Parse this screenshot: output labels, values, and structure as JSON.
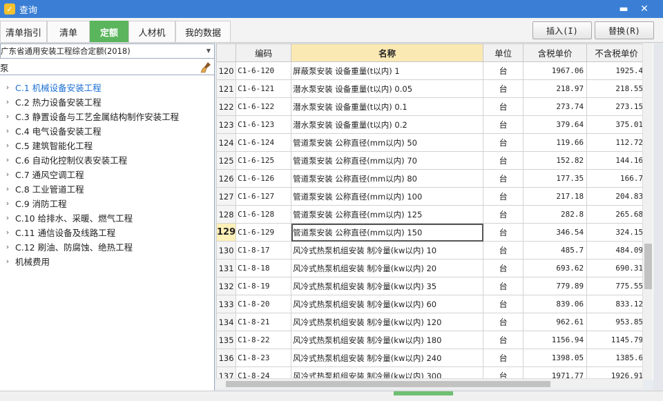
{
  "window": {
    "title": "查询"
  },
  "tabs": [
    {
      "label": "清单指引",
      "active": false
    },
    {
      "label": "清单",
      "active": false
    },
    {
      "label": "定额",
      "active": true
    },
    {
      "label": "人材机",
      "active": false
    },
    {
      "label": "我的数据",
      "active": false
    }
  ],
  "actions": {
    "insert": "插入(I)",
    "replace": "替换(R)"
  },
  "library": {
    "selected": "广东省通用安装工程综合定额(2018)"
  },
  "search": {
    "value": "泵"
  },
  "tree": [
    {
      "label": "C.1 机械设备安装工程",
      "selected": true
    },
    {
      "label": "C.2 热力设备安装工程",
      "selected": false
    },
    {
      "label": "C.3 静置设备与工艺金属结构制作安装工程",
      "selected": false
    },
    {
      "label": "C.4 电气设备安装工程",
      "selected": false
    },
    {
      "label": "C.5 建筑智能化工程",
      "selected": false
    },
    {
      "label": "C.6 自动化控制仪表安装工程",
      "selected": false
    },
    {
      "label": "C.7 通风空调工程",
      "selected": false
    },
    {
      "label": "C.8 工业管道工程",
      "selected": false
    },
    {
      "label": "C.9 消防工程",
      "selected": false
    },
    {
      "label": "C.10 给排水、采暖、燃气工程",
      "selected": false
    },
    {
      "label": "C.11 通信设备及线路工程",
      "selected": false
    },
    {
      "label": "C.12 刷油、防腐蚀、绝热工程",
      "selected": false
    },
    {
      "label": "机械费用",
      "selected": false
    }
  ],
  "table": {
    "headers": {
      "code": "编码",
      "name": "名称",
      "unit": "单位",
      "price_tax": "含税单价",
      "price_notax": "不含税单价"
    },
    "current_row": "129",
    "rows": [
      {
        "no": "120",
        "code": "C1-6-120",
        "name": "屏蔽泵安装 设备重量(t以内) 1",
        "unit": "台",
        "price_tax": "1967.06",
        "price_notax": "1925.4"
      },
      {
        "no": "121",
        "code": "C1-6-121",
        "name": "潜水泵安装 设备重量(t以内) 0.05",
        "unit": "台",
        "price_tax": "218.97",
        "price_notax": "218.55"
      },
      {
        "no": "122",
        "code": "C1-6-122",
        "name": "潜水泵安装 设备重量(t以内) 0.1",
        "unit": "台",
        "price_tax": "273.74",
        "price_notax": "273.15"
      },
      {
        "no": "123",
        "code": "C1-6-123",
        "name": "潜水泵安装 设备重量(t以内) 0.2",
        "unit": "台",
        "price_tax": "379.64",
        "price_notax": "375.01"
      },
      {
        "no": "124",
        "code": "C1-6-124",
        "name": "管道泵安装 公称直径(mm以内) 50",
        "unit": "台",
        "price_tax": "119.66",
        "price_notax": "112.72"
      },
      {
        "no": "125",
        "code": "C1-6-125",
        "name": "管道泵安装 公称直径(mm以内) 70",
        "unit": "台",
        "price_tax": "152.82",
        "price_notax": "144.16"
      },
      {
        "no": "126",
        "code": "C1-6-126",
        "name": "管道泵安装 公称直径(mm以内) 80",
        "unit": "台",
        "price_tax": "177.35",
        "price_notax": "166.7"
      },
      {
        "no": "127",
        "code": "C1-6-127",
        "name": "管道泵安装 公称直径(mm以内) 100",
        "unit": "台",
        "price_tax": "217.18",
        "price_notax": "204.83"
      },
      {
        "no": "128",
        "code": "C1-6-128",
        "name": "管道泵安装 公称直径(mm以内) 125",
        "unit": "台",
        "price_tax": "282.8",
        "price_notax": "265.68"
      },
      {
        "no": "129",
        "code": "C1-6-129",
        "name": "管道泵安装 公称直径(mm以内) 150",
        "unit": "台",
        "price_tax": "346.54",
        "price_notax": "324.15"
      },
      {
        "no": "130",
        "code": "C1-8-17",
        "name": "风冷式热泵机组安装 制冷量(kw以内) 10",
        "unit": "台",
        "price_tax": "485.7",
        "price_notax": "484.09"
      },
      {
        "no": "131",
        "code": "C1-8-18",
        "name": "风冷式热泵机组安装 制冷量(kw以内) 20",
        "unit": "台",
        "price_tax": "693.62",
        "price_notax": "690.31"
      },
      {
        "no": "132",
        "code": "C1-8-19",
        "name": "风冷式热泵机组安装 制冷量(kw以内) 35",
        "unit": "台",
        "price_tax": "779.89",
        "price_notax": "775.55"
      },
      {
        "no": "133",
        "code": "C1-8-20",
        "name": "风冷式热泵机组安装 制冷量(kw以内) 60",
        "unit": "台",
        "price_tax": "839.06",
        "price_notax": "833.12"
      },
      {
        "no": "134",
        "code": "C1-8-21",
        "name": "风冷式热泵机组安装 制冷量(kw以内) 120",
        "unit": "台",
        "price_tax": "962.61",
        "price_notax": "953.85"
      },
      {
        "no": "135",
        "code": "C1-8-22",
        "name": "风冷式热泵机组安装 制冷量(kw以内) 180",
        "unit": "台",
        "price_tax": "1156.94",
        "price_notax": "1145.79"
      },
      {
        "no": "136",
        "code": "C1-8-23",
        "name": "风冷式热泵机组安装 制冷量(kw以内) 240",
        "unit": "台",
        "price_tax": "1398.05",
        "price_notax": "1385.6"
      },
      {
        "no": "137",
        "code": "C1-8-24",
        "name": "风冷式热泵机组安装 制冷量(kw以内) 300",
        "unit": "台",
        "price_tax": "1971.77",
        "price_notax": "1926.91"
      }
    ]
  }
}
